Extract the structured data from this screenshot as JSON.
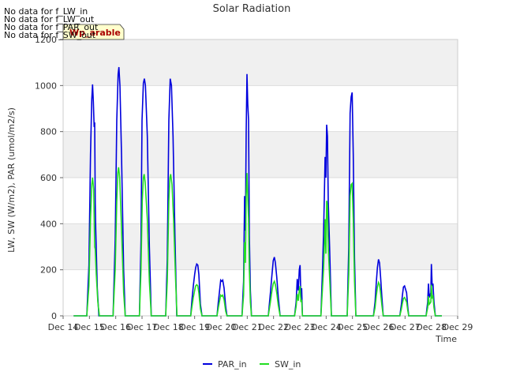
{
  "chart_data": {
    "type": "line",
    "title": "Solar Radiation",
    "xlabel": "Time",
    "ylabel": "LW, SW (W/m2), PAR (umol/m2/s)",
    "ylim": [
      0,
      1200
    ],
    "xlim": [
      14,
      29
    ],
    "yticks": [
      0,
      200,
      400,
      600,
      800,
      1000,
      1200
    ],
    "xticks": [
      14,
      15,
      16,
      17,
      18,
      19,
      20,
      21,
      22,
      23,
      24,
      25,
      26,
      27,
      28,
      29
    ],
    "xtick_labels": [
      "Dec 14",
      "Dec 15",
      "Dec 16",
      "Dec 17",
      "Dec 18",
      "Dec 19",
      "Dec 20",
      "Dec 21",
      "Dec 22",
      "Dec 23",
      "Dec 24",
      "Dec 25",
      "Dec 26",
      "Dec 27",
      "Dec 28",
      "Dec 29"
    ],
    "grid": true,
    "legend_position": "bottom-center",
    "series": [
      {
        "name": "PAR_in",
        "color": "#0000dd",
        "points": [
          [
            14.4,
            0
          ],
          [
            14.9,
            0
          ],
          [
            14.98,
            220
          ],
          [
            15.04,
            700
          ],
          [
            15.09,
            940
          ],
          [
            15.12,
            1005
          ],
          [
            15.15,
            930
          ],
          [
            15.18,
            820
          ],
          [
            15.2,
            840
          ],
          [
            15.22,
            490
          ],
          [
            15.24,
            380
          ],
          [
            15.3,
            120
          ],
          [
            15.36,
            0
          ],
          [
            15.9,
            0
          ],
          [
            15.98,
            330
          ],
          [
            16.04,
            850
          ],
          [
            16.09,
            1050
          ],
          [
            16.12,
            1080
          ],
          [
            16.16,
            1000
          ],
          [
            16.22,
            700
          ],
          [
            16.3,
            200
          ],
          [
            16.36,
            0
          ],
          [
            16.9,
            0
          ],
          [
            16.96,
            330
          ],
          [
            17.0,
            850
          ],
          [
            17.05,
            1010
          ],
          [
            17.09,
            1030
          ],
          [
            17.13,
            1000
          ],
          [
            17.2,
            780
          ],
          [
            17.28,
            300
          ],
          [
            17.35,
            0
          ],
          [
            17.9,
            0
          ],
          [
            17.96,
            250
          ],
          [
            18.02,
            850
          ],
          [
            18.07,
            1030
          ],
          [
            18.12,
            1000
          ],
          [
            18.18,
            780
          ],
          [
            18.25,
            350
          ],
          [
            18.32,
            0
          ],
          [
            18.85,
            0
          ],
          [
            18.9,
            70
          ],
          [
            18.95,
            130
          ],
          [
            19.0,
            180
          ],
          [
            19.04,
            210
          ],
          [
            19.08,
            225
          ],
          [
            19.12,
            220
          ],
          [
            19.16,
            180
          ],
          [
            19.22,
            50
          ],
          [
            19.28,
            0
          ],
          [
            19.85,
            0
          ],
          [
            19.9,
            60
          ],
          [
            19.95,
            110
          ],
          [
            19.99,
            155
          ],
          [
            20.03,
            150
          ],
          [
            20.07,
            155
          ],
          [
            20.12,
            120
          ],
          [
            20.18,
            40
          ],
          [
            20.23,
            0
          ],
          [
            20.8,
            0
          ],
          [
            20.86,
            150
          ],
          [
            20.9,
            520
          ],
          [
            20.93,
            370
          ],
          [
            20.96,
            800
          ],
          [
            20.99,
            1050
          ],
          [
            21.02,
            920
          ],
          [
            21.05,
            850
          ],
          [
            21.08,
            350
          ],
          [
            21.12,
            110
          ],
          [
            21.16,
            0
          ],
          [
            21.8,
            0
          ],
          [
            21.88,
            100
          ],
          [
            21.94,
            180
          ],
          [
            21.99,
            240
          ],
          [
            22.03,
            255
          ],
          [
            22.07,
            230
          ],
          [
            22.12,
            170
          ],
          [
            22.18,
            80
          ],
          [
            22.25,
            0
          ],
          [
            22.8,
            0
          ],
          [
            22.86,
            60
          ],
          [
            22.9,
            160
          ],
          [
            22.94,
            110
          ],
          [
            22.98,
            200
          ],
          [
            23.01,
            220
          ],
          [
            23.04,
            80
          ],
          [
            23.07,
            120
          ],
          [
            23.1,
            0
          ],
          [
            23.8,
            0
          ],
          [
            23.86,
            200
          ],
          [
            23.9,
            350
          ],
          [
            23.93,
            510
          ],
          [
            23.96,
            690
          ],
          [
            23.99,
            600
          ],
          [
            24.02,
            830
          ],
          [
            24.05,
            780
          ],
          [
            24.08,
            500
          ],
          [
            24.13,
            300
          ],
          [
            24.2,
            0
          ],
          [
            24.8,
            0
          ],
          [
            24.86,
            300
          ],
          [
            24.91,
            880
          ],
          [
            24.95,
            950
          ],
          [
            24.99,
            970
          ],
          [
            25.03,
            700
          ],
          [
            25.08,
            250
          ],
          [
            25.13,
            0
          ],
          [
            25.8,
            0
          ],
          [
            25.86,
            60
          ],
          [
            25.91,
            150
          ],
          [
            25.95,
            210
          ],
          [
            25.99,
            245
          ],
          [
            26.03,
            230
          ],
          [
            26.07,
            170
          ],
          [
            26.12,
            80
          ],
          [
            26.17,
            0
          ],
          [
            26.8,
            0
          ],
          [
            26.86,
            50
          ],
          [
            26.9,
            90
          ],
          [
            26.94,
            125
          ],
          [
            26.98,
            130
          ],
          [
            27.02,
            115
          ],
          [
            27.06,
            100
          ],
          [
            27.1,
            40
          ],
          [
            27.14,
            0
          ],
          [
            27.8,
            0
          ],
          [
            27.86,
            60
          ],
          [
            27.89,
            140
          ],
          [
            27.92,
            80
          ],
          [
            27.95,
            90
          ],
          [
            27.98,
            100
          ],
          [
            28.0,
            225
          ],
          [
            28.03,
            130
          ],
          [
            28.06,
            140
          ],
          [
            28.1,
            60
          ],
          [
            28.15,
            0
          ],
          [
            28.4,
            0
          ]
        ]
      },
      {
        "name": "SW_in",
        "color": "#22dd22",
        "points": [
          [
            14.4,
            0
          ],
          [
            14.9,
            0
          ],
          [
            14.98,
            130
          ],
          [
            15.04,
            420
          ],
          [
            15.09,
            570
          ],
          [
            15.12,
            600
          ],
          [
            15.16,
            550
          ],
          [
            15.2,
            300
          ],
          [
            15.22,
            290
          ],
          [
            15.26,
            180
          ],
          [
            15.32,
            60
          ],
          [
            15.38,
            0
          ],
          [
            15.9,
            0
          ],
          [
            15.98,
            200
          ],
          [
            16.04,
            500
          ],
          [
            16.08,
            620
          ],
          [
            16.11,
            645
          ],
          [
            16.15,
            600
          ],
          [
            16.22,
            380
          ],
          [
            16.3,
            100
          ],
          [
            16.36,
            0
          ],
          [
            16.9,
            0
          ],
          [
            16.96,
            200
          ],
          [
            17.01,
            500
          ],
          [
            17.05,
            600
          ],
          [
            17.08,
            615
          ],
          [
            17.12,
            580
          ],
          [
            17.2,
            420
          ],
          [
            17.28,
            150
          ],
          [
            17.35,
            0
          ],
          [
            17.9,
            0
          ],
          [
            17.96,
            150
          ],
          [
            18.02,
            500
          ],
          [
            18.06,
            600
          ],
          [
            18.09,
            615
          ],
          [
            18.14,
            570
          ],
          [
            18.2,
            420
          ],
          [
            18.27,
            180
          ],
          [
            18.33,
            0
          ],
          [
            18.85,
            0
          ],
          [
            18.9,
            40
          ],
          [
            18.95,
            80
          ],
          [
            19.0,
            110
          ],
          [
            19.04,
            130
          ],
          [
            19.08,
            135
          ],
          [
            19.12,
            130
          ],
          [
            19.16,
            100
          ],
          [
            19.22,
            30
          ],
          [
            19.28,
            0
          ],
          [
            19.85,
            0
          ],
          [
            19.9,
            35
          ],
          [
            19.95,
            65
          ],
          [
            19.99,
            90
          ],
          [
            20.03,
            85
          ],
          [
            20.07,
            90
          ],
          [
            20.12,
            70
          ],
          [
            20.18,
            20
          ],
          [
            20.23,
            0
          ],
          [
            20.8,
            0
          ],
          [
            20.86,
            90
          ],
          [
            20.9,
            320
          ],
          [
            20.93,
            230
          ],
          [
            20.96,
            520
          ],
          [
            20.99,
            620
          ],
          [
            21.02,
            520
          ],
          [
            21.05,
            420
          ],
          [
            21.08,
            200
          ],
          [
            21.12,
            60
          ],
          [
            21.16,
            0
          ],
          [
            21.8,
            0
          ],
          [
            21.88,
            60
          ],
          [
            21.94,
            110
          ],
          [
            21.99,
            140
          ],
          [
            22.03,
            150
          ],
          [
            22.07,
            135
          ],
          [
            22.12,
            100
          ],
          [
            22.18,
            45
          ],
          [
            22.25,
            0
          ],
          [
            22.8,
            0
          ],
          [
            22.86,
            40
          ],
          [
            22.9,
            95
          ],
          [
            22.94,
            65
          ],
          [
            22.98,
            110
          ],
          [
            23.01,
            130
          ],
          [
            23.04,
            60
          ],
          [
            23.07,
            70
          ],
          [
            23.1,
            0
          ],
          [
            23.8,
            0
          ],
          [
            23.86,
            120
          ],
          [
            23.9,
            200
          ],
          [
            23.93,
            300
          ],
          [
            23.96,
            420
          ],
          [
            23.99,
            270
          ],
          [
            24.02,
            500
          ],
          [
            24.05,
            480
          ],
          [
            24.08,
            300
          ],
          [
            24.13,
            170
          ],
          [
            24.2,
            0
          ],
          [
            24.8,
            0
          ],
          [
            24.86,
            180
          ],
          [
            24.91,
            520
          ],
          [
            24.95,
            570
          ],
          [
            24.99,
            575
          ],
          [
            25.03,
            420
          ],
          [
            25.08,
            150
          ],
          [
            25.13,
            0
          ],
          [
            25.8,
            0
          ],
          [
            25.86,
            35
          ],
          [
            25.91,
            90
          ],
          [
            25.95,
            125
          ],
          [
            25.99,
            145
          ],
          [
            26.03,
            135
          ],
          [
            26.07,
            100
          ],
          [
            26.12,
            45
          ],
          [
            26.17,
            0
          ],
          [
            26.8,
            0
          ],
          [
            26.86,
            30
          ],
          [
            26.9,
            55
          ],
          [
            26.94,
            75
          ],
          [
            26.98,
            80
          ],
          [
            27.02,
            70
          ],
          [
            27.06,
            60
          ],
          [
            27.1,
            25
          ],
          [
            27.14,
            0
          ],
          [
            27.8,
            0
          ],
          [
            27.86,
            35
          ],
          [
            27.89,
            85
          ],
          [
            27.92,
            50
          ],
          [
            27.95,
            55
          ],
          [
            27.98,
            60
          ],
          [
            28.0,
            135
          ],
          [
            28.03,
            80
          ],
          [
            28.06,
            85
          ],
          [
            28.1,
            35
          ],
          [
            28.15,
            0
          ],
          [
            28.4,
            0
          ]
        ]
      }
    ]
  },
  "notes": [
    "No data for f_LW_in",
    "No data for f_LW_out",
    "No data for f_PAR_out",
    "No data for f_SW_out"
  ],
  "tooltip": "Wp_arable"
}
